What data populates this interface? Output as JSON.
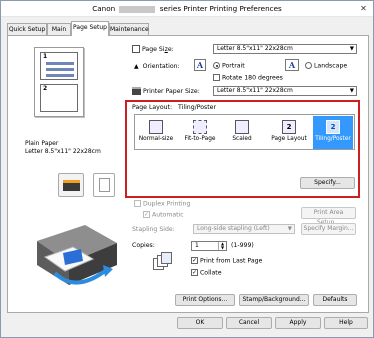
{
  "window": {
    "title_prefix": "Canon",
    "title_suffix": "series Printer Printing Preferences",
    "close_glyph": "✕"
  },
  "tabs": [
    {
      "label": "Quick Setup"
    },
    {
      "label": "Main"
    },
    {
      "label": "Page Setup",
      "active": true
    },
    {
      "label": "Maintenance"
    }
  ],
  "preview": {
    "page1": "1",
    "page2": "2",
    "paper_type": "Plain Paper",
    "paper_size": "Letter 8.5\"x11\" 22x28cm"
  },
  "page_size": {
    "label_pre": "Page Si",
    "label_u": "z",
    "label_post": "e:",
    "value": "Letter 8.5\"x11\" 22x28cm"
  },
  "orientation": {
    "label": "Orientation:",
    "portrait": "Portrait",
    "landscape": "Landscape",
    "selected": "Portrait",
    "rotate_label": "Rotate 180 degrees",
    "rotate_checked": false
  },
  "printer_paper_size": {
    "label": "Printer Paper Size:",
    "value": "Letter 8.5\"x11\" 22x28cm"
  },
  "page_layout": {
    "label": "Page Layout:",
    "value": "Tiling/Poster",
    "items": [
      {
        "label": "Normal-size"
      },
      {
        "label": "Fit-to-Page"
      },
      {
        "label": "Scaled"
      },
      {
        "label": "Page Layout"
      },
      {
        "label": "Tiling/Poster",
        "selected": true
      }
    ],
    "specify_button": "Specify..."
  },
  "duplex": {
    "label": "Duplex Printing",
    "automatic_label": "Automatic",
    "print_area_button": "Print Area Setup..."
  },
  "stapling": {
    "label": "Stapling Side:",
    "value": "Long-side stapling (Left)",
    "specify_margin_button": "Specify Margin..."
  },
  "copies": {
    "label": "Copies:",
    "value": "1",
    "range": "(1-999)",
    "print_from_last_page": "Print from Last Page",
    "print_from_last_checked": true,
    "collate": "Collate",
    "collate_checked": true
  },
  "bottom_buttons": {
    "print_options": "Print Options...",
    "stamp_background": "Stamp/Background...",
    "defaults": "Defaults"
  },
  "dialog_buttons": {
    "ok": "OK",
    "cancel": "Cancel",
    "apply": "Apply",
    "help": "Help"
  },
  "colors": {
    "highlight": "#cc1f1f",
    "selection": "#3399ff"
  }
}
